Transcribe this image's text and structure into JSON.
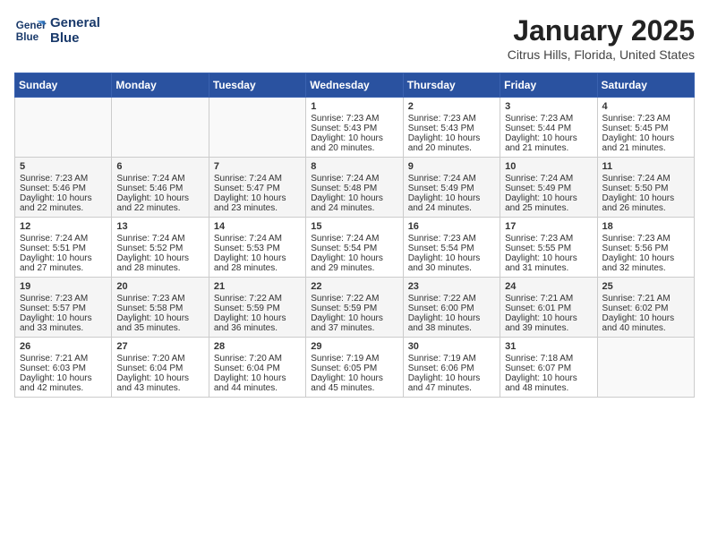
{
  "header": {
    "logo_line1": "General",
    "logo_line2": "Blue",
    "title": "January 2025",
    "subtitle": "Citrus Hills, Florida, United States"
  },
  "days_of_week": [
    "Sunday",
    "Monday",
    "Tuesday",
    "Wednesday",
    "Thursday",
    "Friday",
    "Saturday"
  ],
  "weeks": [
    [
      {
        "day": "",
        "content": ""
      },
      {
        "day": "",
        "content": ""
      },
      {
        "day": "",
        "content": ""
      },
      {
        "day": "1",
        "content": "Sunrise: 7:23 AM\nSunset: 5:43 PM\nDaylight: 10 hours and 20 minutes."
      },
      {
        "day": "2",
        "content": "Sunrise: 7:23 AM\nSunset: 5:43 PM\nDaylight: 10 hours and 20 minutes."
      },
      {
        "day": "3",
        "content": "Sunrise: 7:23 AM\nSunset: 5:44 PM\nDaylight: 10 hours and 21 minutes."
      },
      {
        "day": "4",
        "content": "Sunrise: 7:23 AM\nSunset: 5:45 PM\nDaylight: 10 hours and 21 minutes."
      }
    ],
    [
      {
        "day": "5",
        "content": "Sunrise: 7:23 AM\nSunset: 5:46 PM\nDaylight: 10 hours and 22 minutes."
      },
      {
        "day": "6",
        "content": "Sunrise: 7:24 AM\nSunset: 5:46 PM\nDaylight: 10 hours and 22 minutes."
      },
      {
        "day": "7",
        "content": "Sunrise: 7:24 AM\nSunset: 5:47 PM\nDaylight: 10 hours and 23 minutes."
      },
      {
        "day": "8",
        "content": "Sunrise: 7:24 AM\nSunset: 5:48 PM\nDaylight: 10 hours and 24 minutes."
      },
      {
        "day": "9",
        "content": "Sunrise: 7:24 AM\nSunset: 5:49 PM\nDaylight: 10 hours and 24 minutes."
      },
      {
        "day": "10",
        "content": "Sunrise: 7:24 AM\nSunset: 5:49 PM\nDaylight: 10 hours and 25 minutes."
      },
      {
        "day": "11",
        "content": "Sunrise: 7:24 AM\nSunset: 5:50 PM\nDaylight: 10 hours and 26 minutes."
      }
    ],
    [
      {
        "day": "12",
        "content": "Sunrise: 7:24 AM\nSunset: 5:51 PM\nDaylight: 10 hours and 27 minutes."
      },
      {
        "day": "13",
        "content": "Sunrise: 7:24 AM\nSunset: 5:52 PM\nDaylight: 10 hours and 28 minutes."
      },
      {
        "day": "14",
        "content": "Sunrise: 7:24 AM\nSunset: 5:53 PM\nDaylight: 10 hours and 28 minutes."
      },
      {
        "day": "15",
        "content": "Sunrise: 7:24 AM\nSunset: 5:54 PM\nDaylight: 10 hours and 29 minutes."
      },
      {
        "day": "16",
        "content": "Sunrise: 7:23 AM\nSunset: 5:54 PM\nDaylight: 10 hours and 30 minutes."
      },
      {
        "day": "17",
        "content": "Sunrise: 7:23 AM\nSunset: 5:55 PM\nDaylight: 10 hours and 31 minutes."
      },
      {
        "day": "18",
        "content": "Sunrise: 7:23 AM\nSunset: 5:56 PM\nDaylight: 10 hours and 32 minutes."
      }
    ],
    [
      {
        "day": "19",
        "content": "Sunrise: 7:23 AM\nSunset: 5:57 PM\nDaylight: 10 hours and 33 minutes."
      },
      {
        "day": "20",
        "content": "Sunrise: 7:23 AM\nSunset: 5:58 PM\nDaylight: 10 hours and 35 minutes."
      },
      {
        "day": "21",
        "content": "Sunrise: 7:22 AM\nSunset: 5:59 PM\nDaylight: 10 hours and 36 minutes."
      },
      {
        "day": "22",
        "content": "Sunrise: 7:22 AM\nSunset: 5:59 PM\nDaylight: 10 hours and 37 minutes."
      },
      {
        "day": "23",
        "content": "Sunrise: 7:22 AM\nSunset: 6:00 PM\nDaylight: 10 hours and 38 minutes."
      },
      {
        "day": "24",
        "content": "Sunrise: 7:21 AM\nSunset: 6:01 PM\nDaylight: 10 hours and 39 minutes."
      },
      {
        "day": "25",
        "content": "Sunrise: 7:21 AM\nSunset: 6:02 PM\nDaylight: 10 hours and 40 minutes."
      }
    ],
    [
      {
        "day": "26",
        "content": "Sunrise: 7:21 AM\nSunset: 6:03 PM\nDaylight: 10 hours and 42 minutes."
      },
      {
        "day": "27",
        "content": "Sunrise: 7:20 AM\nSunset: 6:04 PM\nDaylight: 10 hours and 43 minutes."
      },
      {
        "day": "28",
        "content": "Sunrise: 7:20 AM\nSunset: 6:04 PM\nDaylight: 10 hours and 44 minutes."
      },
      {
        "day": "29",
        "content": "Sunrise: 7:19 AM\nSunset: 6:05 PM\nDaylight: 10 hours and 45 minutes."
      },
      {
        "day": "30",
        "content": "Sunrise: 7:19 AM\nSunset: 6:06 PM\nDaylight: 10 hours and 47 minutes."
      },
      {
        "day": "31",
        "content": "Sunrise: 7:18 AM\nSunset: 6:07 PM\nDaylight: 10 hours and 48 minutes."
      },
      {
        "day": "",
        "content": ""
      }
    ]
  ]
}
